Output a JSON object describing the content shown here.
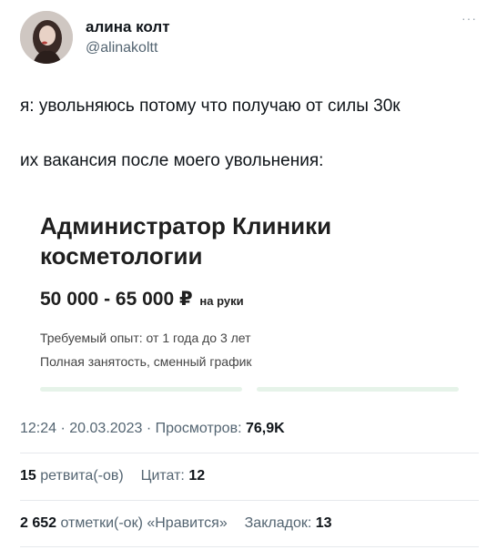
{
  "author": {
    "name": "алина колт",
    "handle": "@alinakoltt"
  },
  "more_label": "···",
  "tweet": {
    "line1": "я: увольняюсь потому что получаю от силы 30к",
    "line2": "их вакансия после моего увольнения:"
  },
  "job_card": {
    "title": "Администратор Клиники косметологии",
    "salary": "50 000 - 65 000 ₽",
    "salary_suffix": "на руки",
    "experience": "Требуемый опыт: от 1 года до 3 лет",
    "schedule": "Полная занятость, сменный график"
  },
  "meta": {
    "time": "12:24",
    "date": "20.03.2023",
    "views_label": "Просмотров:",
    "views_value": "76,9K"
  },
  "stats": {
    "retweets_count": "15",
    "retweets_label": "ретвита(-ов)",
    "quotes_label": "Цитат:",
    "quotes_count": "12",
    "likes_count": "2 652",
    "likes_label": "отметки(-ок) «Нравится»",
    "bookmarks_label": "Закладок:",
    "bookmarks_count": "13"
  },
  "colors": {
    "text": "#0f1419",
    "secondary": "#536471",
    "divider": "#e6e9ec",
    "card_strip": "#e6f3e9"
  }
}
